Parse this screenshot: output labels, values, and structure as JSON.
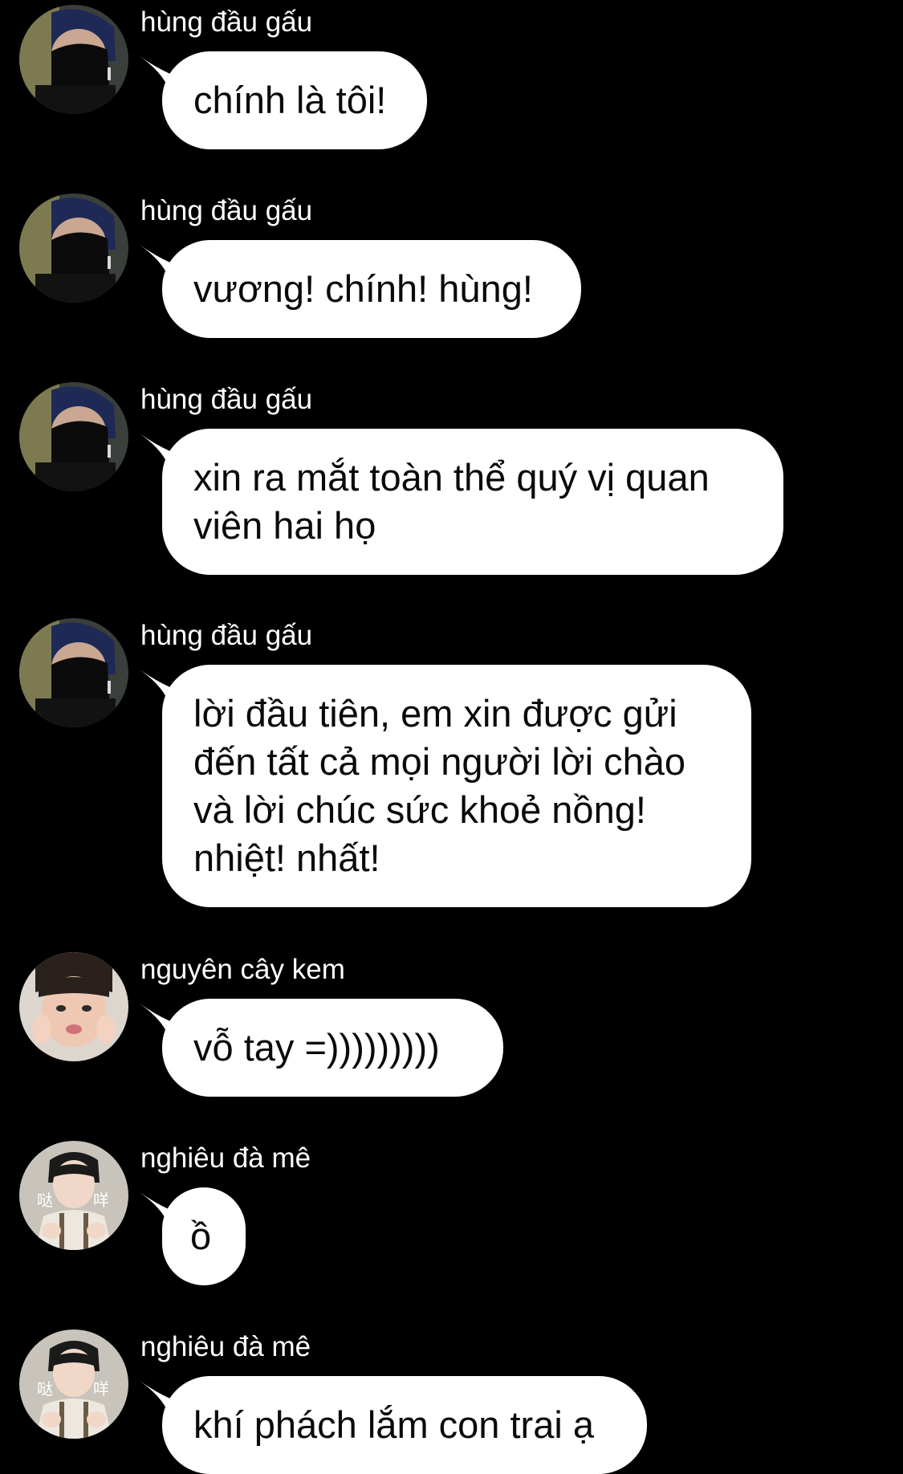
{
  "messages": [
    {
      "sender": "hùng đầu gấu",
      "text": "chính là tôi!",
      "avatar_icon": "masked-man-avatar-icon"
    },
    {
      "sender": "hùng đầu gấu",
      "text": "vương! chính! hùng!",
      "avatar_icon": "masked-man-avatar-icon"
    },
    {
      "sender": "hùng đầu gấu",
      "text": "xin ra mắt toàn thể quý vị quan viên hai họ",
      "avatar_icon": "masked-man-avatar-icon"
    },
    {
      "sender": "hùng đầu gấu",
      "text": "lời đầu tiên, em xin được gửi đến tất cả mọi người lời chào và lời chúc sức khoẻ nồng! nhiệt! nhất!",
      "avatar_icon": "masked-man-avatar-icon"
    },
    {
      "sender": "nguyên cây kem",
      "text": "vỗ tay =)))))))))",
      "avatar_icon": "squished-face-avatar-icon"
    },
    {
      "sender": "nghiêu đà mê",
      "text": "ồ",
      "avatar_icon": "boy-waving-avatar-icon",
      "avatar_caption_left": "哒",
      "avatar_caption_right": "咩"
    },
    {
      "sender": "nghiêu đà mê",
      "text": "khí phách lắm con trai ạ",
      "avatar_icon": "boy-waving-avatar-icon",
      "avatar_caption_left": "哒",
      "avatar_caption_right": "咩"
    }
  ],
  "colors": {
    "background": "#000000",
    "bubble": "#ffffff",
    "bubble_text": "#0a0a0a",
    "sender_text": "#ffffff"
  }
}
